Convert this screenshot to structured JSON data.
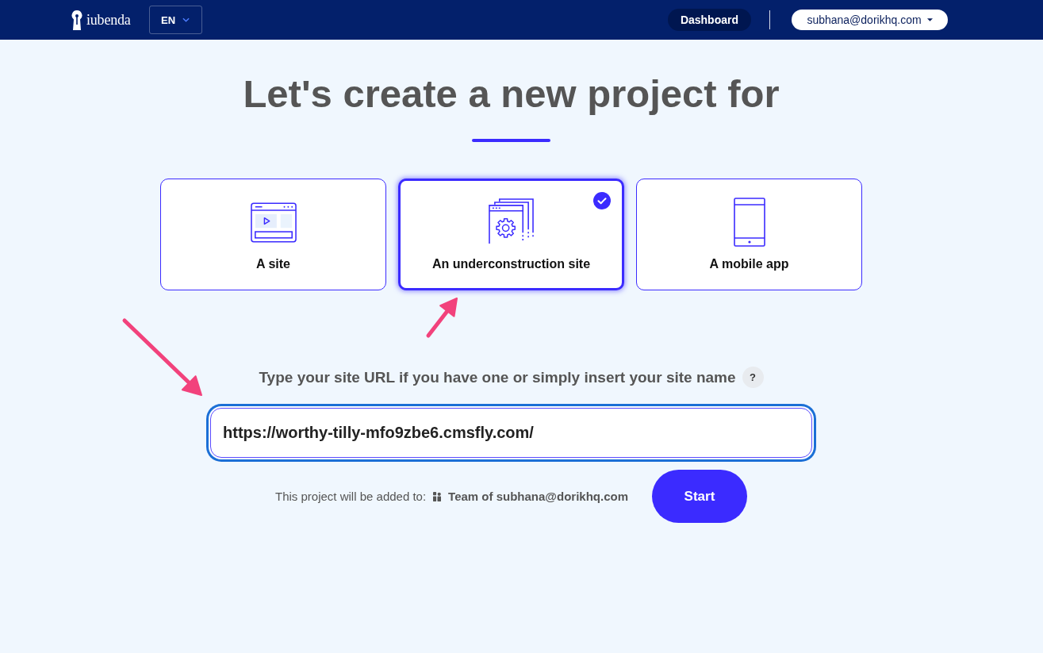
{
  "header": {
    "logo_text": "iubenda",
    "language": "EN",
    "dashboard_button": "Dashboard",
    "account_menu": "subhana@dorikhq.com"
  },
  "title": "Let's create a new project for",
  "project_types": [
    {
      "label": "A site",
      "kind": "site",
      "selected": false
    },
    {
      "label": "An underconstruction site",
      "kind": "construction",
      "selected": true
    },
    {
      "label": "A mobile app",
      "kind": "mobile",
      "selected": false
    }
  ],
  "url_field": {
    "label": "Type your site URL if you have one or simply insert your site name",
    "help": "?",
    "value": "https://worthy-tilly-mfo9zbe6.cmsfly.com/"
  },
  "destination": {
    "prefix": "This project will be added to:",
    "team": "Team of subhana@dorikhq.com"
  },
  "start_button": "Start"
}
